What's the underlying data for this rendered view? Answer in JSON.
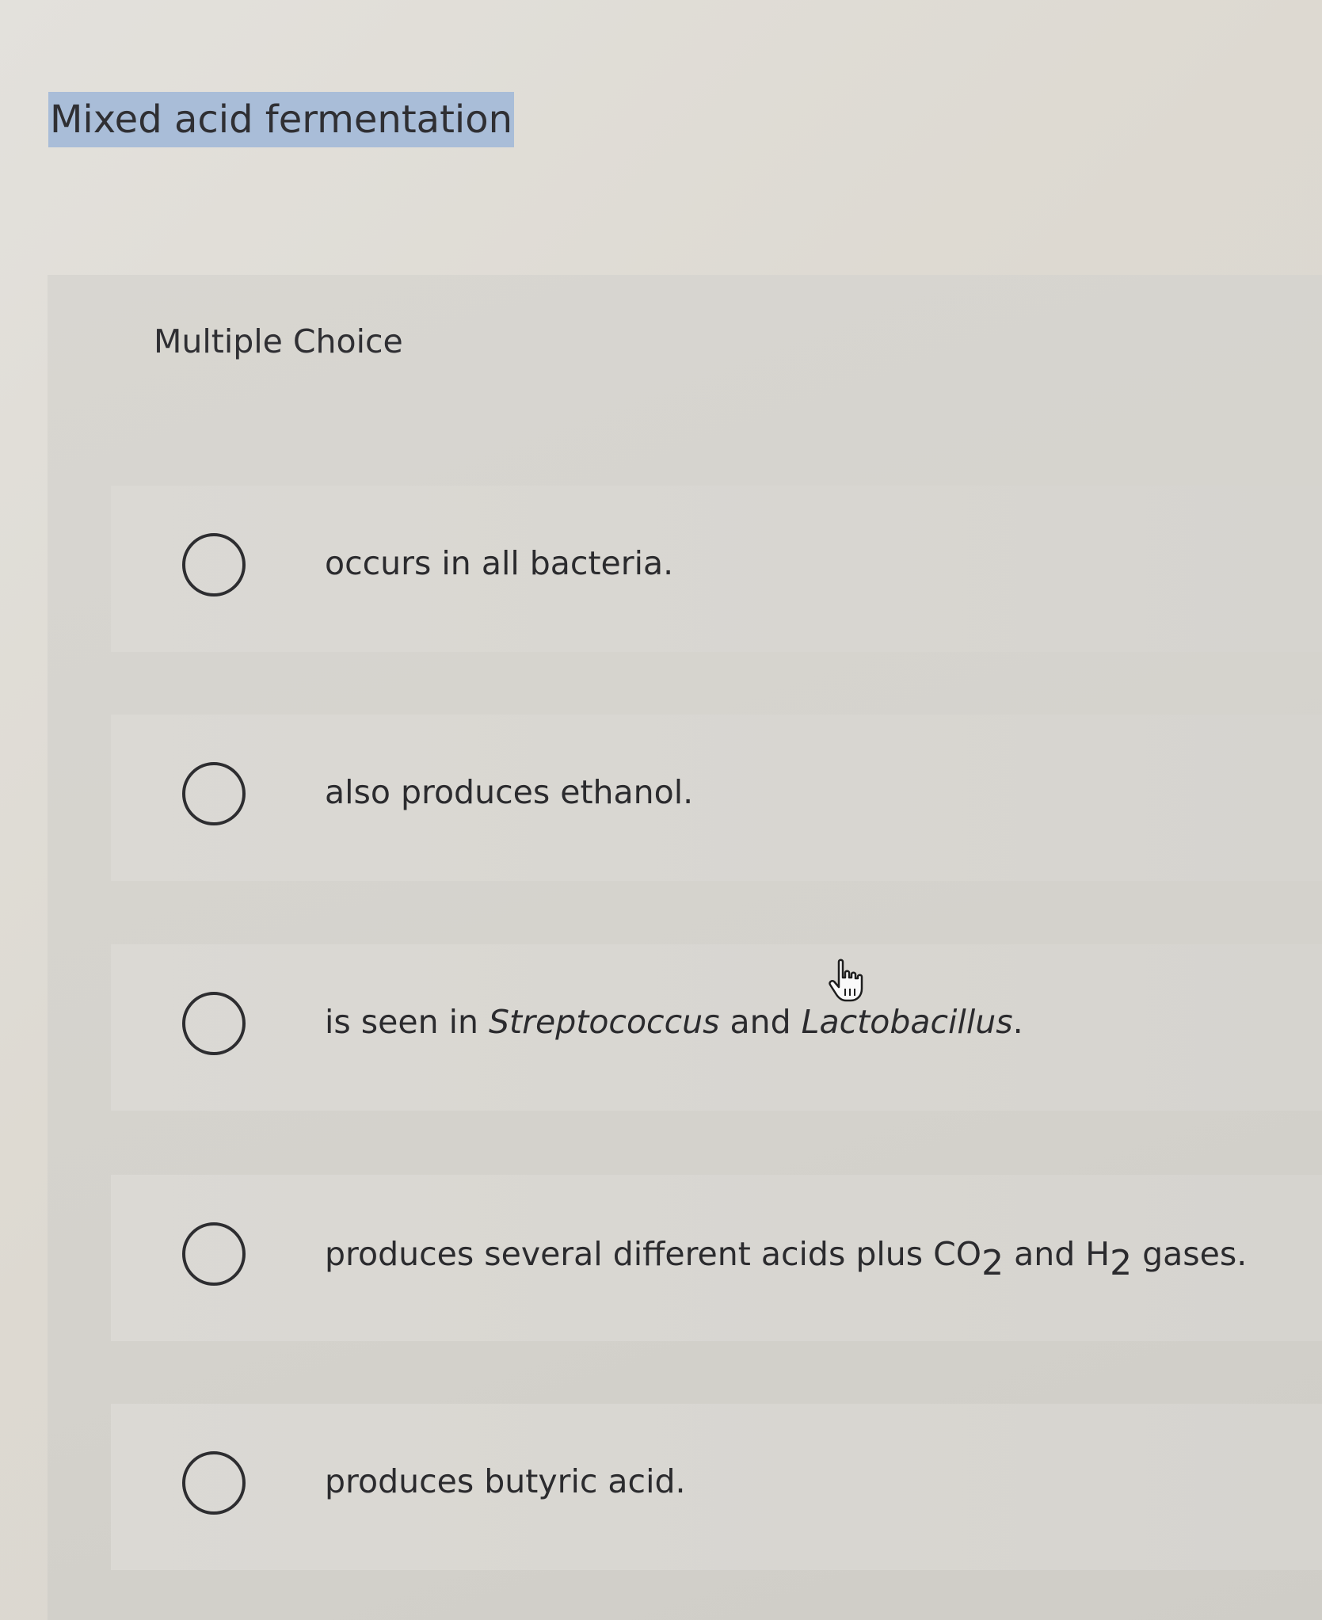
{
  "question": {
    "title": "Mixed acid fermentation",
    "type_label": "Multiple Choice"
  },
  "options": [
    {
      "text": "occurs in all bacteria.",
      "selected": false
    },
    {
      "text": "also produces ethanol.",
      "selected": false
    },
    {
      "text_parts": [
        "is seen in ",
        "Streptococcus",
        " and ",
        "Lactobacillus",
        "."
      ],
      "selected": false
    },
    {
      "text_parts": [
        "produces several different acids plus CO",
        "2",
        " and H",
        "2",
        " gases."
      ],
      "selected": false
    },
    {
      "text": "produces butyric acid.",
      "selected": false
    }
  ],
  "icons": {
    "radio": "radio-empty-icon",
    "cursor": "hand-pointer-icon"
  },
  "colors": {
    "title_highlight": "#a9bdd8",
    "text": "#2b2b2e"
  }
}
